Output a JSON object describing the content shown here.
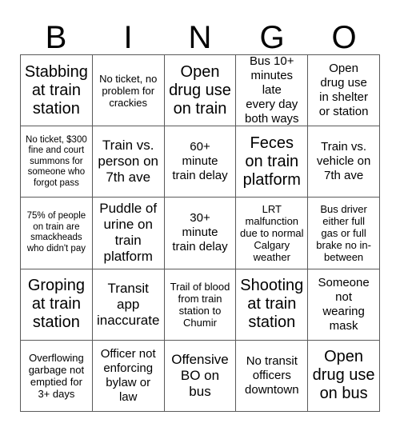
{
  "card": {
    "title_letters": [
      "B",
      "I",
      "N",
      "G",
      "O"
    ],
    "grid_size": 5,
    "colors": {
      "background": "#ffffff",
      "text": "#000000",
      "grid_line": "#5a5a5a"
    },
    "rows": [
      [
        {
          "text": "Stabbing\nat train\nstation",
          "size": "xl"
        },
        {
          "text": "No ticket, no\nproblem for\ncrackies",
          "size": "sm"
        },
        {
          "text": "Open\ndrug use\non train",
          "size": "xl"
        },
        {
          "text": "Bus 10+\nminutes late\nevery day\nboth ways",
          "size": "md"
        },
        {
          "text": "Open\ndrug use\nin shelter\nor station",
          "size": "md"
        }
      ],
      [
        {
          "text": "No ticket, $300\nfine and court\nsummons for\nsomeone who\nforgot pass",
          "size": "xs"
        },
        {
          "text": "Train vs.\nperson on\n7th ave",
          "size": "lg"
        },
        {
          "text": "60+\nminute\ntrain delay",
          "size": "md"
        },
        {
          "text": "Feces\non train\nplatform",
          "size": "xl"
        },
        {
          "text": "Train vs.\nvehicle on\n7th ave",
          "size": "md"
        }
      ],
      [
        {
          "text": "75% of people\non train are\nsmackheads\nwho didn't pay",
          "size": "xs"
        },
        {
          "text": "Puddle of\nurine on\ntrain\nplatform",
          "size": "lg"
        },
        {
          "text": "30+\nminute\ntrain delay",
          "size": "md"
        },
        {
          "text": "LRT\nmalfunction\ndue to normal\nCalgary\nweather",
          "size": "sm"
        },
        {
          "text": "Bus driver\neither full\ngas or full\nbrake no in-\nbetween",
          "size": "sm"
        }
      ],
      [
        {
          "text": "Groping\nat train\nstation",
          "size": "xl"
        },
        {
          "text": "Transit\napp\ninaccurate",
          "size": "lg"
        },
        {
          "text": "Trail of blood\nfrom train\nstation to\nChumir",
          "size": "sm"
        },
        {
          "text": "Shooting\nat train\nstation",
          "size": "xl"
        },
        {
          "text": "Someone\nnot\nwearing\nmask",
          "size": "md"
        }
      ],
      [
        {
          "text": "Overflowing\ngarbage not\nemptied for\n3+ days",
          "size": "sm"
        },
        {
          "text": "Officer not\nenforcing\nbylaw or\nlaw",
          "size": "md"
        },
        {
          "text": "Offensive\nBO on\nbus",
          "size": "lg"
        },
        {
          "text": "No transit\nofficers\ndowntown",
          "size": "md"
        },
        {
          "text": "Open\ndrug use\non bus",
          "size": "xl"
        }
      ]
    ]
  }
}
